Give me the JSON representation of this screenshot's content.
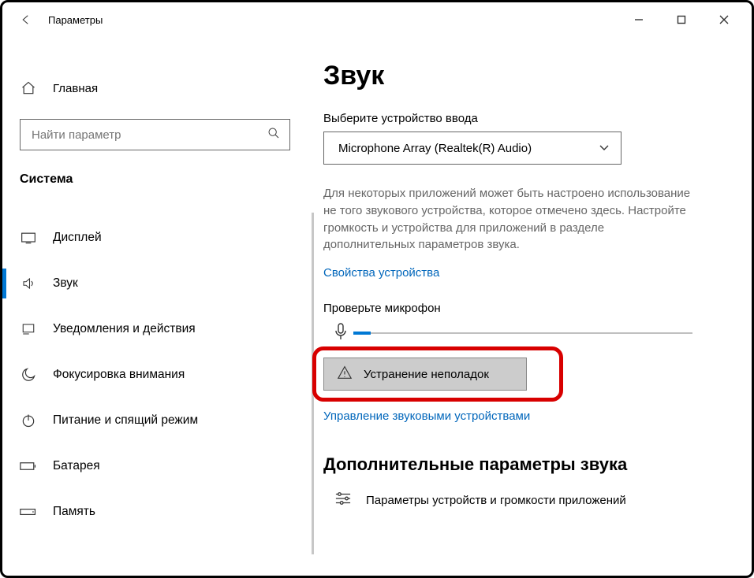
{
  "window": {
    "title": "Параметры"
  },
  "sidebar": {
    "home_label": "Главная",
    "search_placeholder": "Найти параметр",
    "section_label": "Система",
    "items": [
      {
        "label": "Дисплей"
      },
      {
        "label": "Звук"
      },
      {
        "label": "Уведомления и действия"
      },
      {
        "label": "Фокусировка внимания"
      },
      {
        "label": "Питание и спящий режим"
      },
      {
        "label": "Батарея"
      },
      {
        "label": "Память"
      }
    ]
  },
  "content": {
    "title": "Звук",
    "input_label": "Выберите устройство ввода",
    "input_device": "Microphone Array (Realtek(R) Audio)",
    "desc": "Для некоторых приложений может быть настроено использование не того звукового устройства, которое отмечено здесь. Настройте громкость и устройства для приложений в разделе дополнительных параметров звука.",
    "device_props_link": "Свойства устройства",
    "test_label": "Проверьте микрофон",
    "troubleshoot_label": "Устранение неполадок",
    "manage_link": "Управление звуковыми устройствами",
    "advanced_heading": "Дополнительные параметры звука",
    "advanced_item": "Параметры устройств и громкости приложений"
  }
}
